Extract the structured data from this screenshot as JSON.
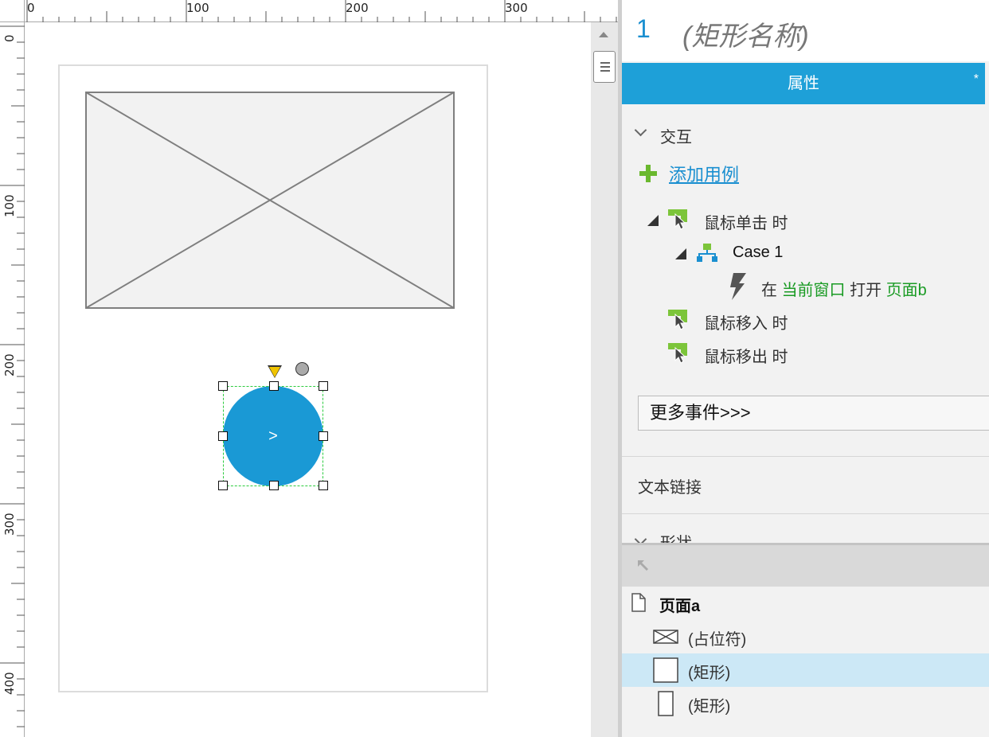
{
  "ruler": {
    "top_labels": [
      "0",
      "100",
      "200",
      "300"
    ],
    "left_labels": [
      "0",
      "100",
      "200",
      "300",
      "400"
    ]
  },
  "canvas": {
    "circle_label": ">"
  },
  "inspector": {
    "index": "1",
    "name": "(矩形名称)",
    "tab_label": "属性",
    "tab_marker": "*"
  },
  "interaction": {
    "section_title": "交互",
    "add_case_label": "添加用例",
    "events": [
      {
        "label": "鼠标单击 时",
        "case": {
          "label": "Case 1",
          "action": {
            "prefix": "在",
            "target": "当前窗口",
            "verb": "打开",
            "page": "页面b"
          }
        }
      },
      {
        "label": "鼠标移入 时"
      },
      {
        "label": "鼠标移出 时"
      }
    ],
    "more_events_label": "更多事件>>>"
  },
  "sections": {
    "text_link": "文本链接",
    "shape": "形状"
  },
  "outline": {
    "items": [
      {
        "label": "页面a",
        "icon": "page-icon"
      },
      {
        "label": "(占位符)",
        "icon": "placeholder-icon"
      },
      {
        "label": "(矩形)",
        "icon": "rectangle-icon",
        "selected": true
      },
      {
        "label": "(矩形)",
        "icon": "narrow-rectangle-icon"
      }
    ]
  },
  "colors": {
    "accent": "#1ea0d8",
    "circle_fill": "#1a99d5",
    "selection": "#2ecc40",
    "action_green": "#1a9b24",
    "event_green": "#7cc53a",
    "selected_row": "#cce8f6"
  }
}
